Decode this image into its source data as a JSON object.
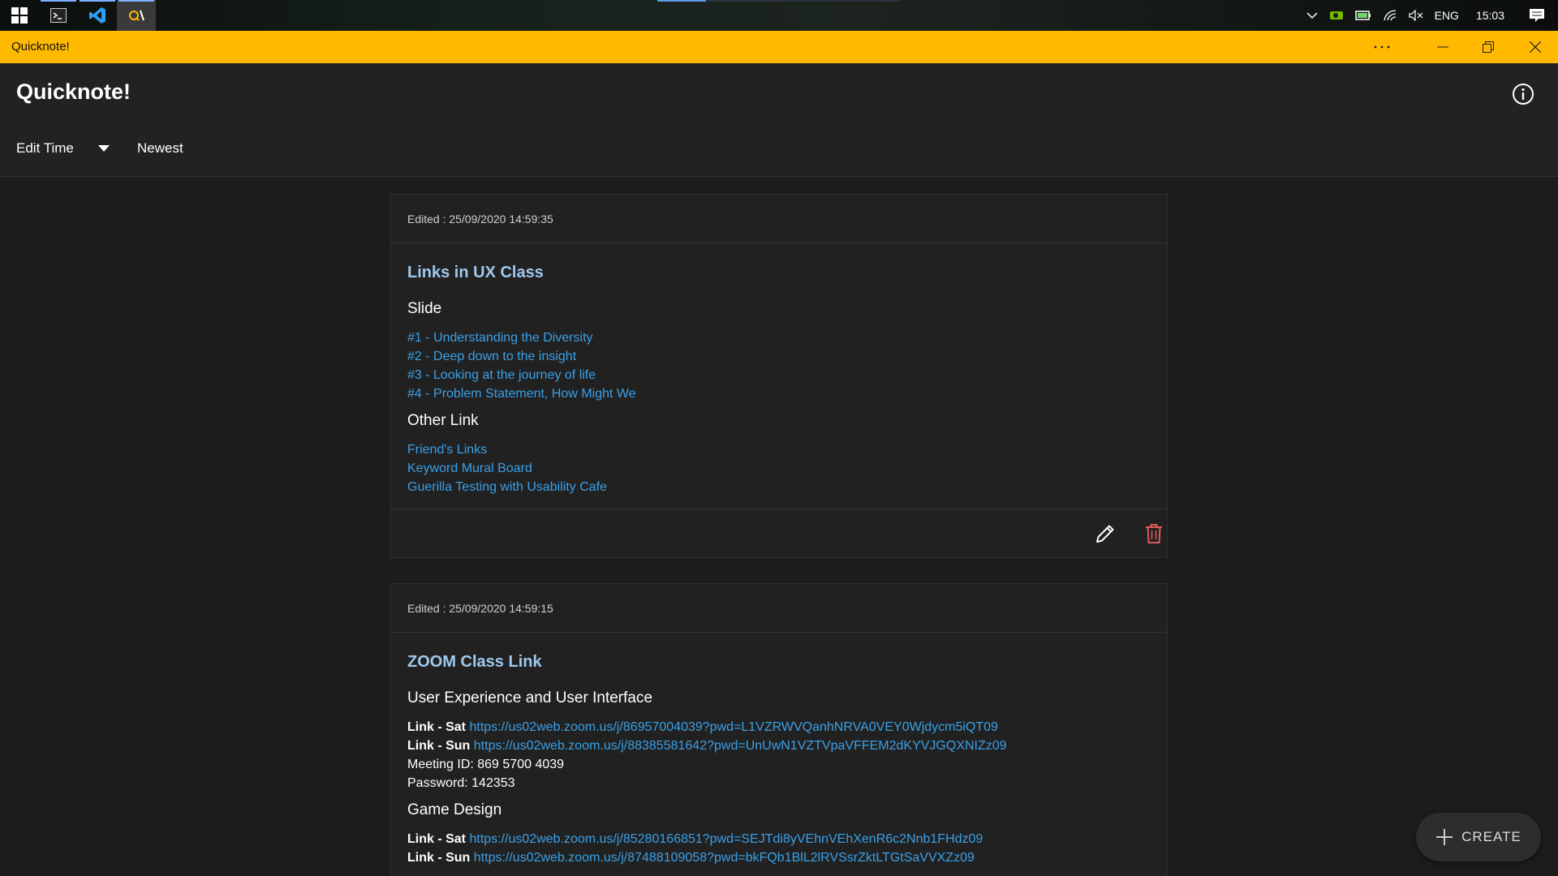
{
  "taskbar": {
    "language": "ENG",
    "time": "15:03"
  },
  "window": {
    "title": "Quicknote!"
  },
  "header": {
    "app_title": "Quicknote!",
    "sort_field": "Edit Time",
    "sort_order": "Newest"
  },
  "notes": [
    {
      "edited": "Edited : 25/09/2020 14:59:35",
      "title": "Links in UX Class",
      "sections": [
        {
          "heading": "Slide",
          "links": [
            "#1 - Understanding the Diversity",
            "#2 - Deep down to the insight",
            "#3 - Looking at the journey of life",
            "#4 - Problem Statement, How Might We"
          ]
        },
        {
          "heading": "Other Link",
          "links": [
            "Friend's Links",
            "Keyword Mural Board",
            "Guerilla Testing with Usability Cafe"
          ]
        }
      ]
    },
    {
      "edited": "Edited : 25/09/2020 14:59:15",
      "title": "ZOOM Class Link",
      "sections": [
        {
          "heading": "User Experience and User Interface",
          "lines": [
            {
              "label": "Link - Sat",
              "url": "https://us02web.zoom.us/j/86957004039?pwd=L1VZRWVQanhNRVA0VEY0Wjdycm5iQT09"
            },
            {
              "label": "Link - Sun",
              "url": "https://us02web.zoom.us/j/88385581642?pwd=UnUwN1VZTVpaVFFEM2dKYVJGQXNIZz09"
            },
            {
              "text": "Meeting ID: 869 5700 4039"
            },
            {
              "text": "Password: 142353"
            }
          ]
        },
        {
          "heading": "Game Design",
          "lines": [
            {
              "label": "Link - Sat",
              "url": "https://us02web.zoom.us/j/85280166851?pwd=SEJTdi8yVEhnVEhXenR6c2Nnb1FHdz09"
            },
            {
              "label": "Link - Sun",
              "url": "https://us02web.zoom.us/j/87488109058?pwd=bkFQb1BlL2lRVSsrZktLTGtSaVVXZz09"
            }
          ]
        }
      ]
    }
  ],
  "fab": {
    "label": "CREATE"
  },
  "colors": {
    "accent": "#ffb900",
    "link": "#3aa0e8",
    "note_title": "#9fc9ef",
    "delete": "#e05a5a"
  }
}
